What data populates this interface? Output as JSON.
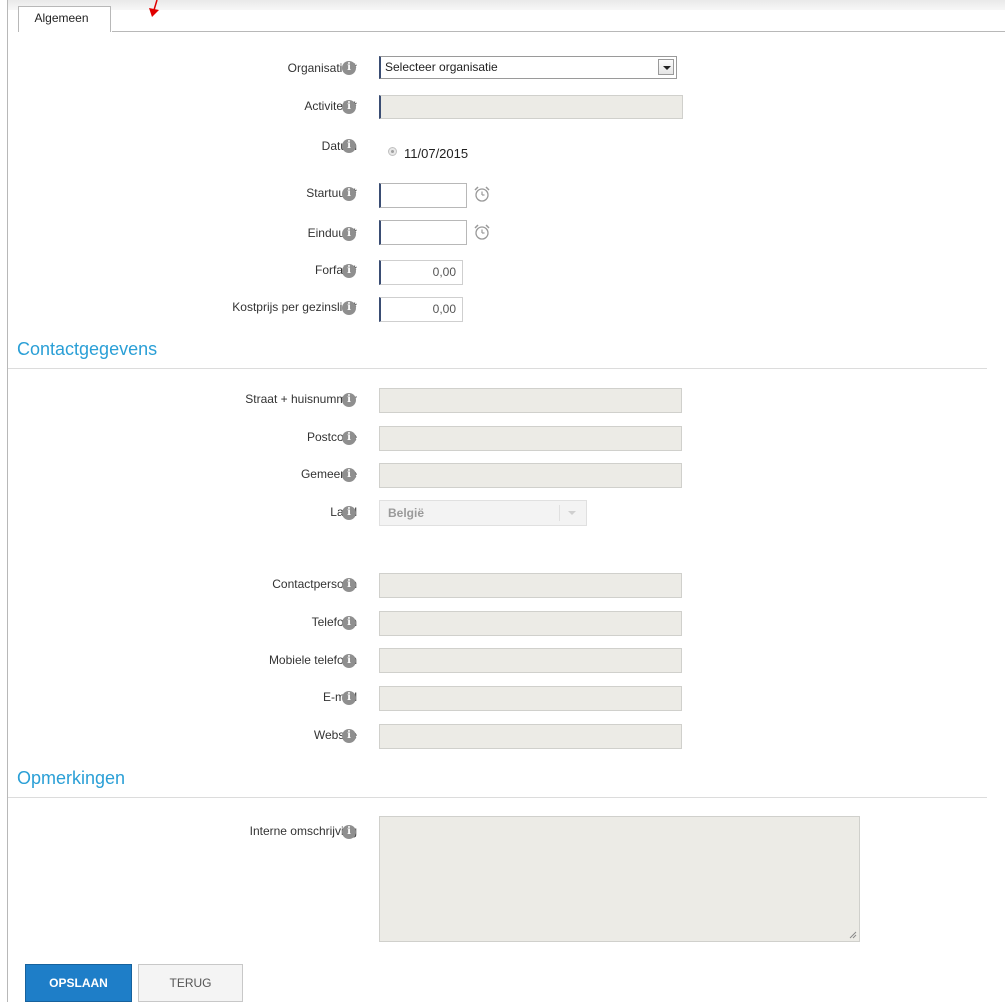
{
  "tabs": [
    {
      "label": "Algemeen",
      "active": true
    }
  ],
  "colors": {
    "accent": "#2a9fd6",
    "primary_button": "#1e7ec8",
    "annotation_arrow": "#e00000",
    "readonly_field": "#ecebe6"
  },
  "general": {
    "organisatie": {
      "label": "Organisatie *",
      "value": "Selecteer organisatie"
    },
    "activiteit": {
      "label": "Activiteit *"
    },
    "datum": {
      "label": "Datum",
      "value": "11/07/2015"
    },
    "startuur": {
      "label": "Startuur *"
    },
    "einduur": {
      "label": "Einduur *"
    },
    "forfait": {
      "label": "Forfait *",
      "value": "0,00"
    },
    "kostprijs": {
      "label": "Kostprijs per gezinslid *",
      "value": "0,00"
    }
  },
  "contact": {
    "title": "Contactgegevens",
    "straat": {
      "label": "Straat + huisnummer"
    },
    "postcode": {
      "label": "Postcode"
    },
    "gemeente": {
      "label": "Gemeente"
    },
    "land": {
      "label": "Land",
      "value": "België"
    },
    "contactpersoon": {
      "label": "Contactpersoon"
    },
    "telefoon": {
      "label": "Telefoon"
    },
    "mobiel": {
      "label": "Mobiele telefoon"
    },
    "email": {
      "label": "E-mail"
    },
    "website": {
      "label": "Website"
    }
  },
  "remarks": {
    "title": "Opmerkingen",
    "interne": {
      "label": "Interne omschrijving"
    }
  },
  "buttons": {
    "save": "OPSLAAN",
    "back": "TERUG"
  },
  "icons": {
    "info": "info-icon",
    "clock": "alarm-clock-icon",
    "arrow": "red-arrow-annotation"
  }
}
